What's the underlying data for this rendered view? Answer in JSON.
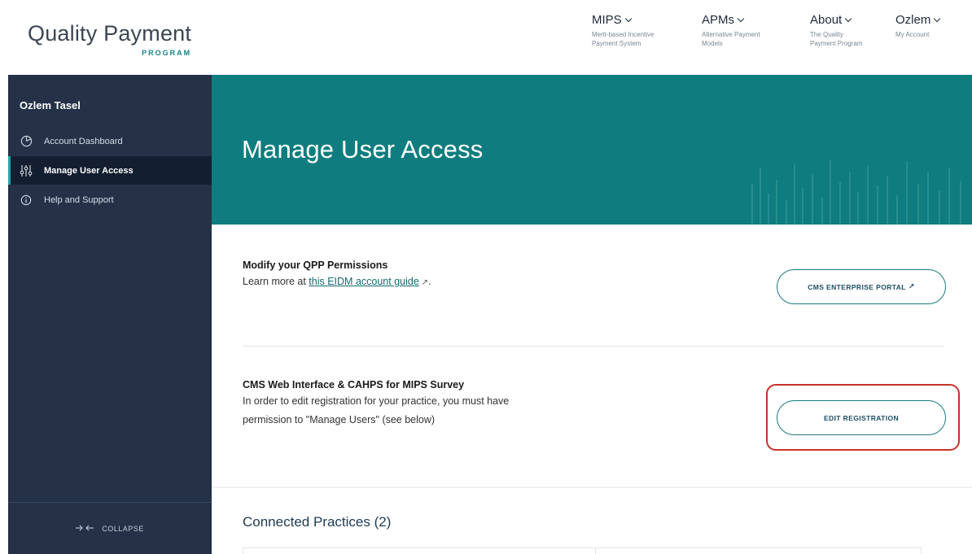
{
  "logo": {
    "main": "Quality Payment",
    "sub": "PROGRAM"
  },
  "nav": [
    {
      "title": "MIPS",
      "sub": "Merit-based Incentive Payment System"
    },
    {
      "title": "APMs",
      "sub": "Alternative Payment Models"
    },
    {
      "title": "About",
      "sub": "The Quality Payment Program"
    },
    {
      "title": "Ozlem",
      "sub": "My Account"
    }
  ],
  "sidebar": {
    "user_name": "Ozlem Tasel",
    "items": [
      {
        "label": "Account Dashboard",
        "icon": "dashboard-icon"
      },
      {
        "label": "Manage User Access",
        "icon": "sliders-icon"
      },
      {
        "label": "Help and Support",
        "icon": "info-icon"
      }
    ],
    "collapse_label": "COLLAPSE"
  },
  "hero": {
    "title": "Manage User Access"
  },
  "permissions": {
    "title": "Modify your QPP Permissions",
    "text_prefix": "Learn more at ",
    "link_text": "this EIDM account guide",
    "text_suffix": ".",
    "button_label": "CMS ENTERPRISE PORTAL"
  },
  "registration": {
    "title": "CMS Web Interface & CAHPS for MIPS Survey",
    "line1": "In order to edit registration for your practice, you must have",
    "line2": "permission to \"Manage Users\" (see below)",
    "button_label": "EDIT REGISTRATION"
  },
  "connected": {
    "title": "Connected Practices (2)"
  },
  "colors": {
    "teal": "#0f7d7f",
    "navy": "#243146",
    "highlight": "#c8312c"
  }
}
